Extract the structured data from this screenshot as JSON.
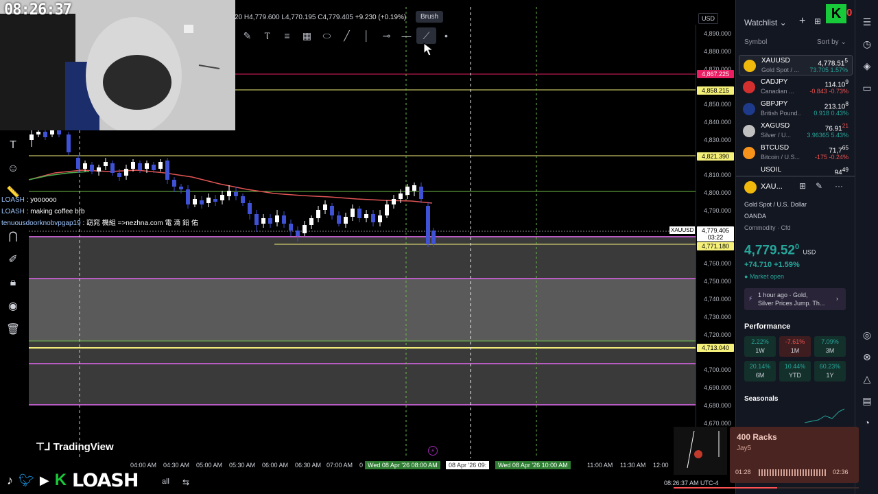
{
  "clock": "08:26:37",
  "ohlc": {
    "o": "20",
    "h": "H4,779.600",
    "l": "L4,770.195",
    "c": "C4,779.405",
    "change": "+9.230 (+0.19%)"
  },
  "brush_tooltip": "Brush",
  "currency": "USD",
  "symbol_tag": "XAUUSD",
  "chat": [
    {
      "user": "LOASH",
      "text": ": yoooooo"
    },
    {
      "user": "LOASH",
      "text": ": making coffee brb"
    },
    {
      "user": "tenuousdoorknobvpgap19",
      "text": ": 窈窕 機組 =>nezhna.com 電 滴 鉛 佑"
    }
  ],
  "price_ticks": [
    "4,890.000",
    "4,880.000",
    "4,870.000",
    "4,850.000",
    "4,840.000",
    "4,830.000",
    "4,810.000",
    "4,800.000",
    "4,790.000",
    "4,760.000",
    "4,750.000",
    "4,740.000",
    "4,730.000",
    "4,720.000",
    "4,700.000",
    "4,690.000",
    "4,680.000",
    "4,670.000"
  ],
  "price_tags": {
    "pink": "4,867.225",
    "yellow1": "4,858.215",
    "yellow2": "4,821.390",
    "current": "4,779.405",
    "countdown": "03:22",
    "yellow3": "4,771.180",
    "yellow4": "4,713.040"
  },
  "time_ticks": [
    "04:00 AM",
    "04:30 AM",
    "05:00 AM",
    "05:30 AM",
    "06:00 AM",
    "06:30 AM",
    "07:00 AM",
    "0",
    "11:00 AM",
    "11:30 AM",
    "12:00"
  ],
  "time_highlights": {
    "start": "Wed 08 Apr '26 08:00 AM",
    "mid": "08 Apr '26  09:",
    "end": "Wed 08 Apr '26 10:00 AM"
  },
  "tradingview_logo": "TradingView",
  "brand": "LOASH",
  "watchlist": {
    "title": "Watchlist",
    "col_symbol": "Symbol",
    "sort": "Sort by",
    "rows": [
      {
        "sym": "XAUUSD",
        "desc": "Gold Spot / ...",
        "last": "4,778.51",
        "last_sup": "5",
        "chg": "73.705",
        "pct": "1.57%",
        "dir": "up",
        "color": "#f0b90b"
      },
      {
        "sym": "CADJPY",
        "desc": "Canadian ...",
        "last": "114.10",
        "last_sup": "9",
        "chg": "-0.843",
        "pct": "-0.73%",
        "dir": "down",
        "color": "#d32f2f"
      },
      {
        "sym": "GBPJPY",
        "desc": "British Pound...",
        "last": "213.10",
        "last_sup": "8",
        "chg": "0.918",
        "pct": "0.43%",
        "dir": "up",
        "color": "#1e3a8a"
      },
      {
        "sym": "XAGUSD",
        "desc": "Silver / U...",
        "last": "76.91",
        "last_sup": "21",
        "chg": "3.96365",
        "pct": "5.43%",
        "dir": "up",
        "color": "#c0c0c0"
      },
      {
        "sym": "BTCUSD",
        "desc": "Bitcoin / U.S...",
        "last": "71,7",
        "last_sup": "65",
        "chg": "-175",
        "pct": "-0.24%",
        "dir": "down",
        "color": "#f7931a"
      },
      {
        "sym": "USOIL",
        "desc": "",
        "last": "94",
        "last_sup": "49",
        "chg": "",
        "pct": "",
        "dir": "down",
        "color": "#555"
      }
    ]
  },
  "details": {
    "sym": "XAU...",
    "name": "Gold Spot / U.S. Dollar",
    "exchange": "OANDA",
    "type": "Commodity · Cfd",
    "price_main": "4,779.52",
    "price_sup": "0",
    "price_ccy": "USD",
    "change": "+74.710 +1.59%",
    "market": "Market open",
    "news_time": "1 hour ago · Gold,",
    "news_text": "Silver Prices Jump. Th..."
  },
  "performance": {
    "title": "Performance",
    "items": [
      {
        "v": "2.22%",
        "l": "1W",
        "dir": "g"
      },
      {
        "v": "-7.61%",
        "l": "1M",
        "dir": "r"
      },
      {
        "v": "7.09%",
        "l": "3M",
        "dir": "g"
      },
      {
        "v": "20.14%",
        "l": "6M",
        "dir": "g"
      },
      {
        "v": "10.44%",
        "l": "YTD",
        "dir": "g"
      },
      {
        "v": "60.23%",
        "l": "1Y",
        "dir": "g"
      }
    ]
  },
  "seasonals": "Seasonals",
  "music": {
    "title": "400 Racks",
    "artist": "Jay5",
    "elapsed": "01:28",
    "total": "02:36",
    "progress": 0.56
  },
  "bottom_time": "08:26:37 AM UTC-4"
}
